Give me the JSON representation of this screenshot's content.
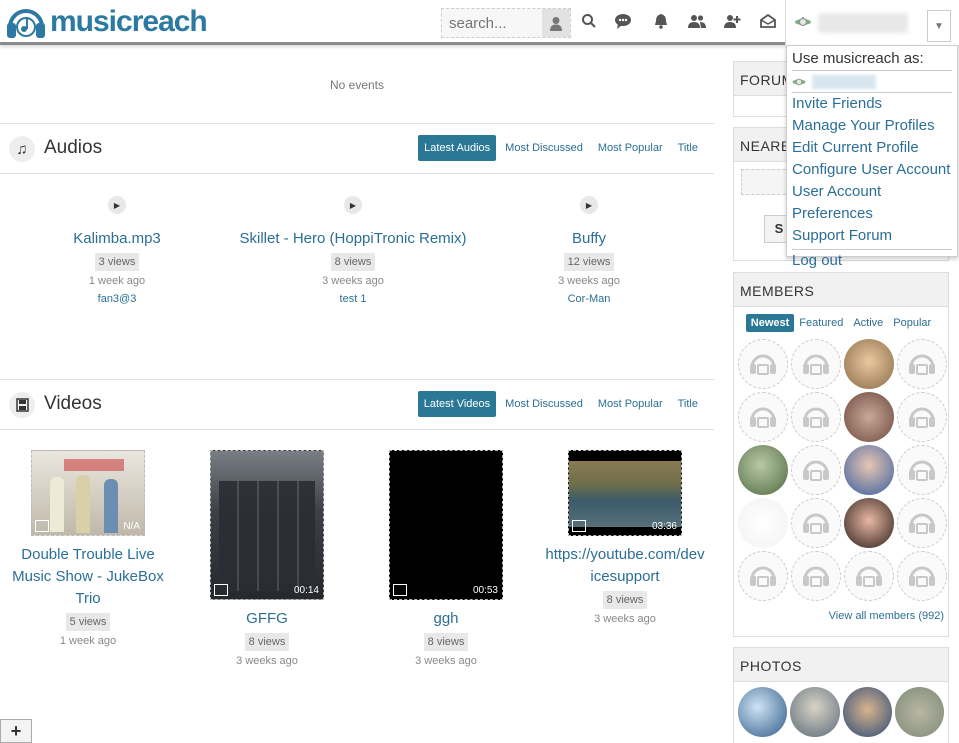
{
  "header": {
    "logo_text": "musicreach",
    "search_placeholder": "search..."
  },
  "events": {
    "empty_text": "No events"
  },
  "audios": {
    "title": "Audios",
    "tabs": [
      "Latest Audios",
      "Most Discussed",
      "Most Popular",
      "Title"
    ],
    "items": [
      {
        "title": "Kalimba.mp3",
        "views": "3 views",
        "age": "1 week ago",
        "author": "fan3@3"
      },
      {
        "title": "Skillet - Hero (HoppiTronic Remix)",
        "views": "8 views",
        "age": "3 weeks ago",
        "author": "test 1"
      },
      {
        "title": "Buffy",
        "views": "12 views",
        "age": "3 weeks ago",
        "author": "Cor-Man"
      }
    ]
  },
  "videos": {
    "title": "Videos",
    "tabs": [
      "Latest Videos",
      "Most Discussed",
      "Most Popular",
      "Title"
    ],
    "items": [
      {
        "title": "Double Trouble Live Music Show - JukeBox Trio",
        "views": "5 views",
        "age": "1 week ago",
        "duration": "N/A"
      },
      {
        "title": "GFFG",
        "views": "8 views",
        "age": "3 weeks ago",
        "duration": "00:14"
      },
      {
        "title": "ggh",
        "views": "8 views",
        "age": "3 weeks ago",
        "duration": "00:53"
      },
      {
        "title": "https://youtube.com/devicesupport",
        "views": "8 views",
        "age": "3 weeks ago",
        "duration": "03:36"
      }
    ]
  },
  "sidebar": {
    "forum_title": "FORUM",
    "nearby_title": "NEARBY",
    "members": {
      "title": "MEMBERS",
      "tabs": [
        "Newest",
        "Featured",
        "Active",
        "Popular"
      ],
      "view_all": "View all members (992)"
    },
    "photos_title": "PHOTOS"
  },
  "dropdown": {
    "heading": "Use musicreach as:",
    "items": [
      "Invite Friends",
      "Manage Your Profiles",
      "Edit Current Profile",
      "Configure User Account",
      "User Account Preferences",
      "Support Forum"
    ],
    "logout": "Log out"
  },
  "footer": {
    "plus_label": "+"
  },
  "colors": {
    "brand": "#2c7aa3",
    "link": "#2b6f96",
    "active_tab": "#2b7896"
  }
}
